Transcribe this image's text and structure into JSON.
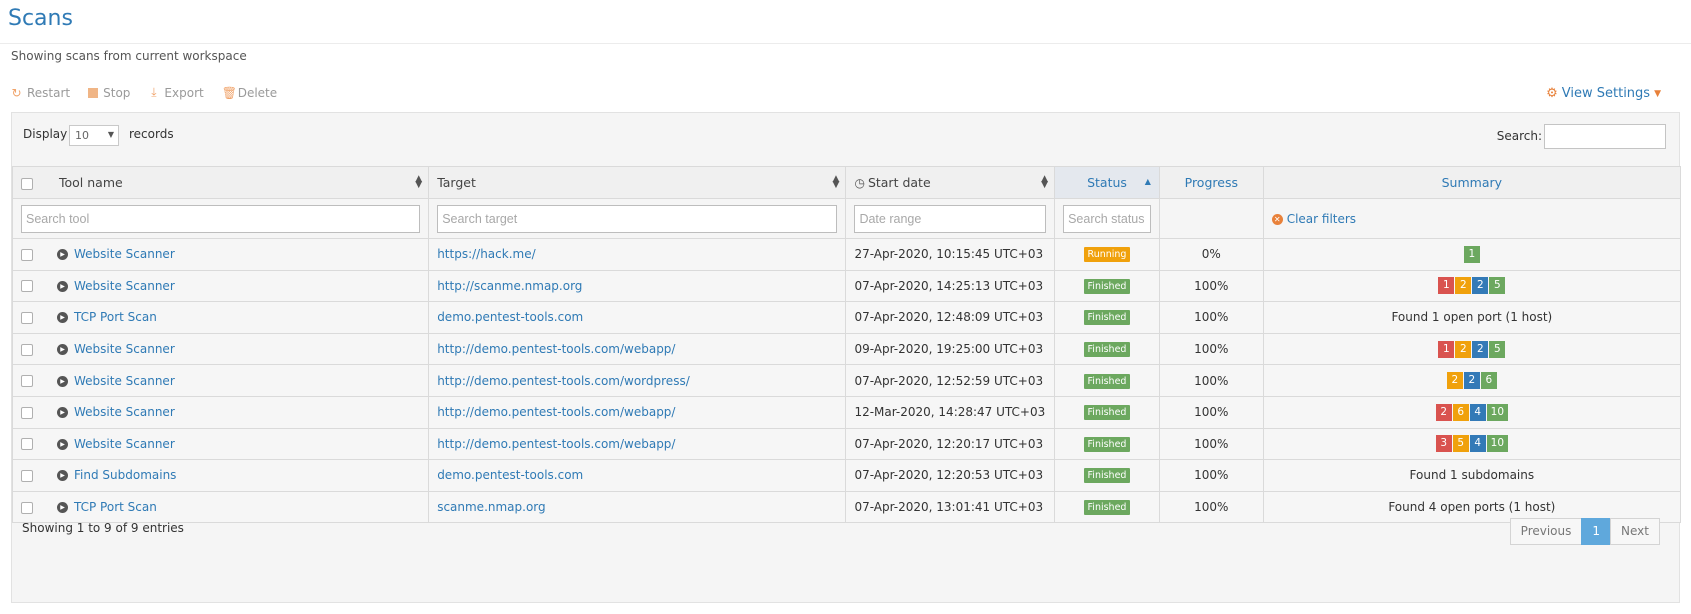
{
  "page": {
    "title": "Scans",
    "subtitle": "Showing scans from current workspace"
  },
  "toolbar": {
    "restart": "Restart",
    "stop": "Stop",
    "export": "Export",
    "delete": "Delete",
    "view_settings": "View Settings"
  },
  "controls": {
    "display_label": "Display",
    "page_size": "10",
    "records_label": "records",
    "search_label": "Search:"
  },
  "columns": {
    "tool_name": "Tool name",
    "target": "Target",
    "start_date": "Start date",
    "status": "Status",
    "progress": "Progress",
    "summary": "Summary"
  },
  "filters": {
    "tool_placeholder": "Search tool",
    "target_placeholder": "Search target",
    "date_placeholder": "Date range",
    "status_placeholder": "Search status",
    "clear_label": "Clear filters"
  },
  "rows": [
    {
      "tool": "Website Scanner",
      "target": "https://hack.me/",
      "date": "27-Apr-2020, 10:15:45 UTC+03",
      "status": "Running",
      "progress": "0%",
      "summary_text": "",
      "summary": [
        {
          "v": "1",
          "c": "green"
        }
      ]
    },
    {
      "tool": "Website Scanner",
      "target": "http://scanme.nmap.org",
      "date": "07-Apr-2020, 14:25:13 UTC+03",
      "status": "Finished",
      "progress": "100%",
      "summary_text": "",
      "summary": [
        {
          "v": "1",
          "c": "red"
        },
        {
          "v": "2",
          "c": "orange"
        },
        {
          "v": "2",
          "c": "blue"
        },
        {
          "v": "5",
          "c": "green"
        }
      ]
    },
    {
      "tool": "TCP Port Scan",
      "target": "demo.pentest-tools.com",
      "date": "07-Apr-2020, 12:48:09 UTC+03",
      "status": "Finished",
      "progress": "100%",
      "summary_text": "Found 1 open port (1 host)",
      "summary": []
    },
    {
      "tool": "Website Scanner",
      "target": "http://demo.pentest-tools.com/webapp/",
      "date": "09-Apr-2020, 19:25:00 UTC+03",
      "status": "Finished",
      "progress": "100%",
      "summary_text": "",
      "summary": [
        {
          "v": "1",
          "c": "red"
        },
        {
          "v": "2",
          "c": "orange"
        },
        {
          "v": "2",
          "c": "blue"
        },
        {
          "v": "5",
          "c": "green"
        }
      ]
    },
    {
      "tool": "Website Scanner",
      "target": "http://demo.pentest-tools.com/wordpress/",
      "date": "07-Apr-2020, 12:52:59 UTC+03",
      "status": "Finished",
      "progress": "100%",
      "summary_text": "",
      "summary": [
        {
          "v": "2",
          "c": "orange"
        },
        {
          "v": "2",
          "c": "blue"
        },
        {
          "v": "6",
          "c": "green"
        }
      ]
    },
    {
      "tool": "Website Scanner",
      "target": "http://demo.pentest-tools.com/webapp/",
      "date": "12-Mar-2020, 14:28:47 UTC+03",
      "status": "Finished",
      "progress": "100%",
      "summary_text": "",
      "summary": [
        {
          "v": "2",
          "c": "red"
        },
        {
          "v": "6",
          "c": "orange"
        },
        {
          "v": "4",
          "c": "blue"
        },
        {
          "v": "10",
          "c": "green"
        }
      ]
    },
    {
      "tool": "Website Scanner",
      "target": "http://demo.pentest-tools.com/webapp/",
      "date": "07-Apr-2020, 12:20:17 UTC+03",
      "status": "Finished",
      "progress": "100%",
      "summary_text": "",
      "summary": [
        {
          "v": "3",
          "c": "red"
        },
        {
          "v": "5",
          "c": "orange"
        },
        {
          "v": "4",
          "c": "blue"
        },
        {
          "v": "10",
          "c": "green"
        }
      ]
    },
    {
      "tool": "Find Subdomains",
      "target": "demo.pentest-tools.com",
      "date": "07-Apr-2020, 12:20:53 UTC+03",
      "status": "Finished",
      "progress": "100%",
      "summary_text": "Found 1 subdomains",
      "summary": []
    },
    {
      "tool": "TCP Port Scan",
      "target": "scanme.nmap.org",
      "date": "07-Apr-2020, 13:01:41 UTC+03",
      "status": "Finished",
      "progress": "100%",
      "summary_text": "Found 4 open ports (1 host)",
      "summary": []
    }
  ],
  "footer": {
    "info": "Showing 1 to 9 of 9 entries",
    "previous": "Previous",
    "current_page": "1",
    "next": "Next"
  },
  "colors": {
    "accent": "#2f7ab5",
    "orange": "#e8813a",
    "running": "#f0a10c",
    "finished": "#6ca85f"
  }
}
